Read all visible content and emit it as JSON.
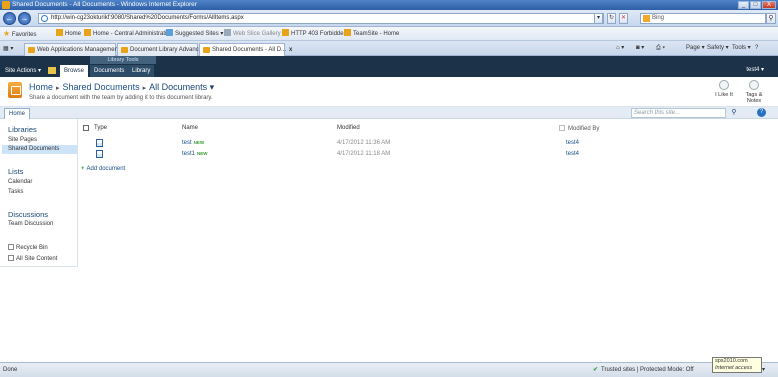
{
  "window": {
    "title": "Shared Documents - All Documents - Windows Internet Explorer",
    "minimize": "_",
    "maximize": "□",
    "close": "X"
  },
  "address": {
    "back": "←",
    "forward": "→",
    "url": "http://win-cg23okturikf:9080/Shared%20Documents/Forms/AllItems.aspx",
    "dropdown": "▾",
    "refresh": "↻",
    "stop": "✕",
    "search_placeholder": "Bing",
    "search_go": "⚲"
  },
  "favorites": {
    "label": "Favorites",
    "items": [
      "Home",
      "Home - Central Administration",
      "Suggested Sites ▾",
      "Web Slice Gallery ▾",
      "HTTP 403 Forbidden",
      "TeamSite - Home"
    ]
  },
  "tabs": {
    "items": [
      "Web Applications Management",
      "Document Library Advanced ...",
      "Shared Documents - All D..."
    ],
    "close": "x",
    "commands": [
      "Page ▾",
      "Safety ▾",
      "Tools ▾",
      "?"
    ]
  },
  "ribbon": {
    "site_actions": "Site Actions ▾",
    "context_group": "Library Tools",
    "tabs": [
      "Browse",
      "Documents",
      "Library"
    ],
    "user": "test4 ▾"
  },
  "title_area": {
    "crumbs": [
      "Home",
      "Shared Documents",
      "All Documents ▾"
    ],
    "separator": "▸",
    "description": "Share a document with the team by adding it to this document library.",
    "i_like_it": "I Like It",
    "tags_notes": "Tags & Notes"
  },
  "topnav": {
    "home": "Home",
    "search_placeholder": "Search this site...",
    "search_go": "⚲",
    "help": "?"
  },
  "leftnav": {
    "libraries": "Libraries",
    "library_items": [
      "Site Pages",
      "Shared Documents"
    ],
    "lists": "Lists",
    "list_items": [
      "Calendar",
      "Tasks"
    ],
    "discussions": "Discussions",
    "discussion_items": [
      "Team Discussion"
    ],
    "recycle_bin": "Recycle Bin",
    "all_site_content": "All Site Content"
  },
  "list": {
    "columns": [
      "Type",
      "Name",
      "Modified",
      "Modified By"
    ],
    "rows": [
      {
        "name": "test",
        "new": "NEW",
        "modified": "4/17/2012 11:36 AM",
        "modified_by": "test4"
      },
      {
        "name": "test1",
        "new": "NEW",
        "modified": "4/17/2012 11:18 AM",
        "modified_by": "test4"
      }
    ],
    "add_document": "Add document"
  },
  "status": {
    "text": "Done",
    "zone": "Trusted sites | Protected Mode: Off",
    "tooltip_line1": "sps2010.com",
    "tooltip_line2": "Internet access",
    "zoom": "▾"
  }
}
